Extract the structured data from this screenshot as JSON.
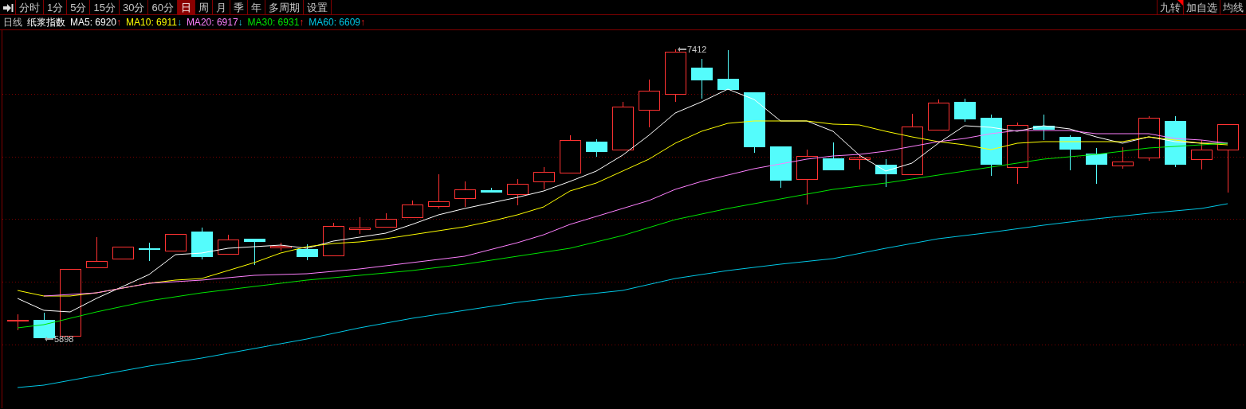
{
  "toolbar": {
    "tabs": [
      {
        "label": "分时",
        "selected": false
      },
      {
        "label": "1分",
        "selected": false
      },
      {
        "label": "5分",
        "selected": false
      },
      {
        "label": "15分",
        "selected": false
      },
      {
        "label": "30分",
        "selected": false
      },
      {
        "label": "60分",
        "selected": false
      },
      {
        "label": "日",
        "selected": true
      },
      {
        "label": "周",
        "selected": false
      },
      {
        "label": "月",
        "selected": false
      },
      {
        "label": "季",
        "selected": false
      },
      {
        "label": "年",
        "selected": false
      },
      {
        "label": "多周期",
        "selected": false
      },
      {
        "label": "设置",
        "selected": false
      }
    ],
    "right_buttons": [
      {
        "label": "九转",
        "marked": true
      },
      {
        "label": "加自选",
        "marked": false
      },
      {
        "label": "均线",
        "marked": false
      }
    ]
  },
  "legend": {
    "period": "日线",
    "name": "纸浆指数",
    "indicators": [
      {
        "label": "MA5: 6920",
        "color": "#ffffff",
        "arrow": "↑",
        "rising": true
      },
      {
        "label": "MA10: 6911",
        "color": "#ffff00",
        "arrow": "↓",
        "rising": false
      },
      {
        "label": "MA20: 6917",
        "color": "#ff80ff",
        "arrow": "↓",
        "rising": false
      },
      {
        "label": "MA30: 6931",
        "color": "#00e600",
        "arrow": "↑",
        "rising": true
      },
      {
        "label": "MA60: 6609",
        "color": "#00c8e6",
        "arrow": "↑",
        "rising": true
      }
    ]
  },
  "chart": {
    "high_label": "7412",
    "low_label": "5898"
  }
}
